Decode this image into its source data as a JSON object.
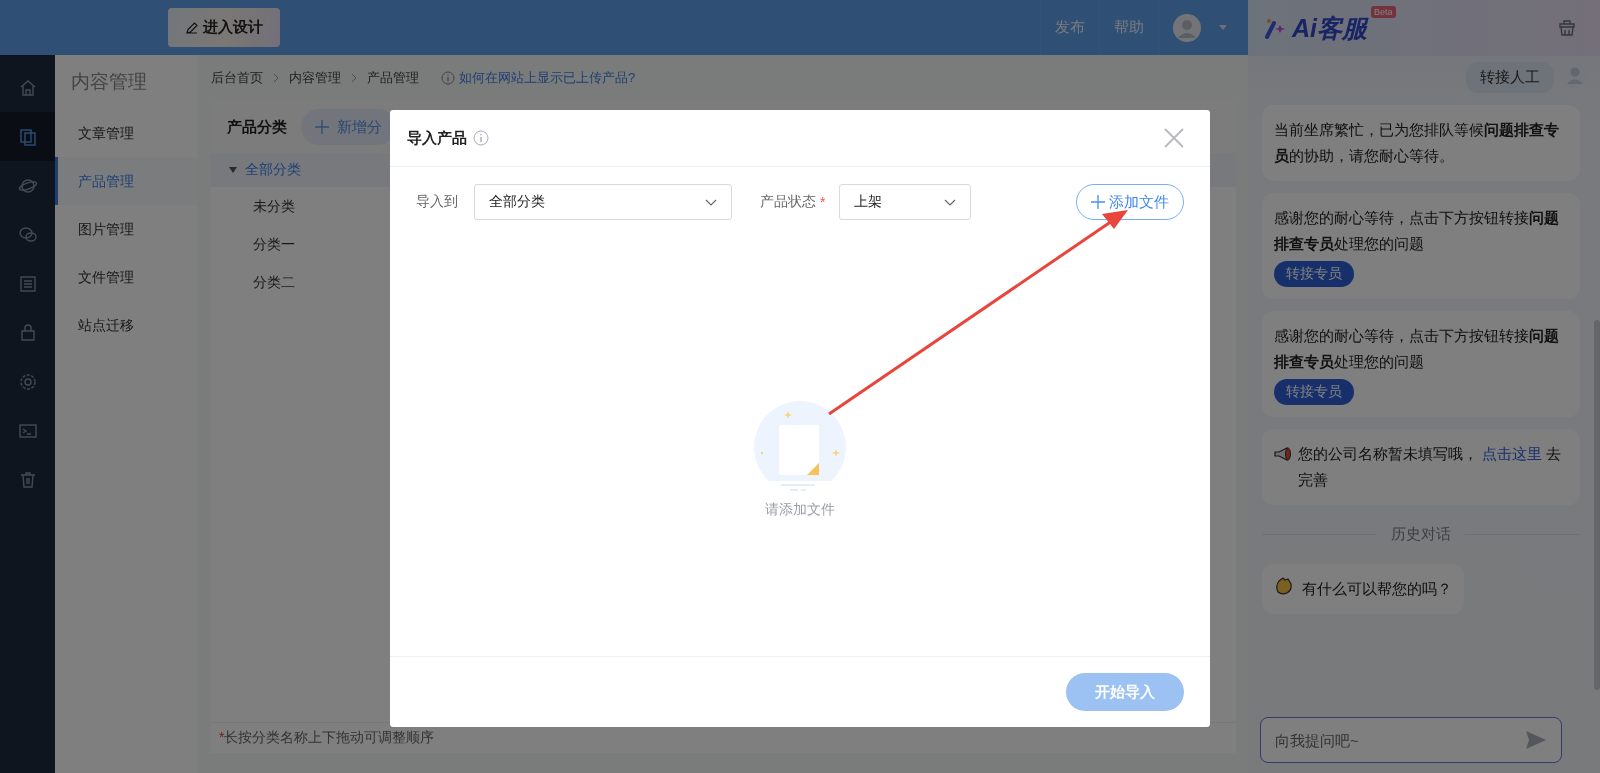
{
  "topbar": {
    "design_button": "进入设计",
    "links": [
      "发布",
      "帮助"
    ]
  },
  "rail": [
    {
      "selected": false
    },
    {
      "selected": true
    },
    {
      "selected": false
    },
    {
      "selected": false
    },
    {
      "selected": false
    },
    {
      "selected": false
    },
    {
      "selected": false
    },
    {
      "selected": false
    },
    {
      "selected": false
    }
  ],
  "sidebar": {
    "title": "内容管理",
    "items": [
      {
        "label": "文章管理",
        "selected": false
      },
      {
        "label": "产品管理",
        "selected": true
      },
      {
        "label": "图片管理",
        "selected": false
      },
      {
        "label": "文件管理",
        "selected": false
      },
      {
        "label": "站点迁移",
        "selected": false
      }
    ]
  },
  "breadcrumb": {
    "items": [
      "后台首页",
      "内容管理",
      "产品管理"
    ],
    "help_link": "如何在网站上显示已上传产品?"
  },
  "category_panel": {
    "title": "产品分类",
    "add_button": "新增分",
    "tree": [
      {
        "label": "全部分类",
        "selected": true,
        "expanded": true,
        "children": [
          {
            "label": "未分类",
            "selected": false
          },
          {
            "label": "分类一",
            "selected": false
          },
          {
            "label": "分类二",
            "selected": false
          }
        ]
      }
    ],
    "note_mark": "*",
    "note": "长按分类名称上下拖动可调整顺序"
  },
  "dialog": {
    "title": "导入产品",
    "target_label": "导入到",
    "target_value": "全部分类",
    "status_label": "产品状态",
    "required_mark": "*",
    "status_value": "上架",
    "add_file_button": "添加文件",
    "empty_text": "请添加文件",
    "start_button": "开始导入",
    "start_disabled": true
  },
  "chat": {
    "logo": "Ai客服",
    "badge": "Beta",
    "messages": [
      {
        "kind": "user",
        "text": "转接人工"
      },
      {
        "kind": "bot",
        "text": "当前坐席繁忙，已为您排队等候**问题排查专员**的协助，请您耐心等待。"
      },
      {
        "kind": "bot",
        "text": "感谢您的耐心等待，点击下方按钮转接**问题排查专员**处理您的问题",
        "button": "转接专员"
      },
      {
        "kind": "bot",
        "text": "感谢您的耐心等待，点击下方按钮转接**问题排查专员**处理您的问题",
        "button": "转接专员"
      },
      {
        "kind": "notice",
        "text": "您的公司名称暂未填写哦，",
        "link": "点击这里",
        "after": "去完善"
      },
      {
        "kind": "divider",
        "text": "历史对话"
      },
      {
        "kind": "greeting",
        "text": "有什么可以帮您的吗？"
      }
    ],
    "input": {
      "placeholder": "向我提问吧~"
    }
  }
}
